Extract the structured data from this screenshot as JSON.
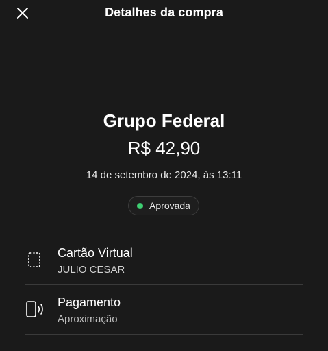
{
  "header": {
    "title": "Detalhes da compra",
    "close_icon": "close-icon"
  },
  "transaction": {
    "merchant": "Grupo Federal",
    "amount": "R$ 42,90",
    "datetime": "14 de setembro de 2024, às 13:11",
    "status": "Aprovada",
    "status_color": "#3ecf72"
  },
  "details": [
    {
      "icon": "card-icon",
      "title": "Cartão Virtual",
      "subtitle": "JULIO CESAR"
    },
    {
      "icon": "contactless-phone-icon",
      "title": "Pagamento",
      "subtitle": "Aproximação"
    }
  ],
  "colors": {
    "background": "#1a1a1a",
    "text_primary": "#ffffff",
    "text_secondary": "#bdbdbd",
    "divider": "#3a3a3a"
  }
}
